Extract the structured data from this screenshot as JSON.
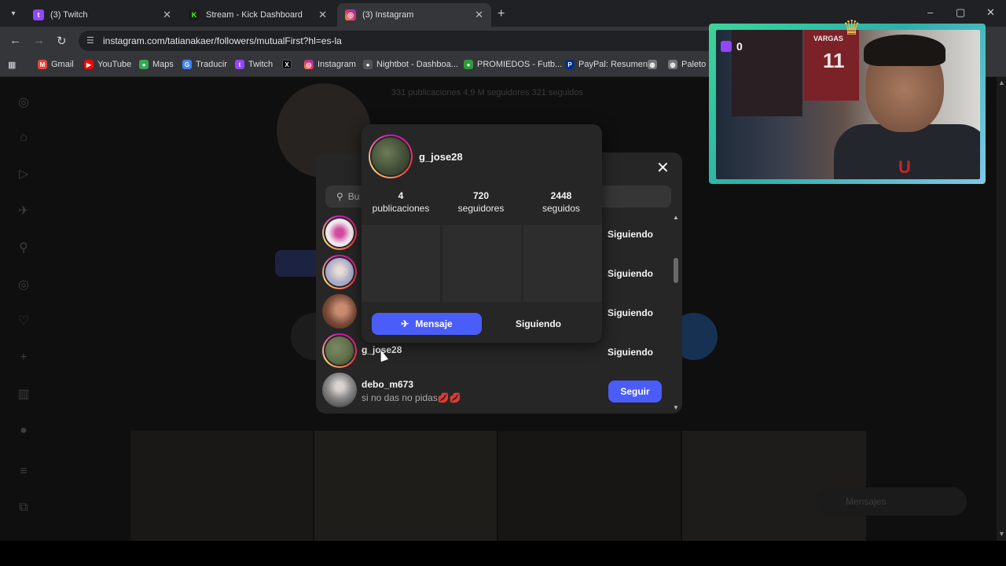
{
  "browser": {
    "tabs": [
      {
        "title": "(3) Twitch",
        "icon": "twitch-icon",
        "color": "#9146ff",
        "active": false
      },
      {
        "title": "Stream - Kick Dashboard",
        "icon": "kick-icon",
        "color": "#53fc18",
        "active": false
      },
      {
        "title": "(3) Instagram",
        "icon": "instagram-icon",
        "color": "#e1306c",
        "active": true
      }
    ],
    "url": "instagram.com/tatianakaer/followers/mutualFirst?hl=es-la",
    "bookmarks": [
      {
        "label": "Gmail",
        "icon": "gmail-icon",
        "color": "#ea4335"
      },
      {
        "label": "YouTube",
        "icon": "youtube-icon",
        "color": "#ff0000"
      },
      {
        "label": "Maps",
        "icon": "maps-icon",
        "color": "#34a853"
      },
      {
        "label": "Traducir",
        "icon": "translate-icon",
        "color": "#4285f4"
      },
      {
        "label": "Twitch",
        "icon": "twitch-icon",
        "color": "#9146ff"
      },
      {
        "label": "",
        "icon": "x-icon",
        "color": "#000000"
      },
      {
        "label": "Instagram",
        "icon": "instagram-icon",
        "color": "#e1306c"
      },
      {
        "label": "Nightbot - Dashboa...",
        "icon": "nightbot-icon",
        "color": "#666666"
      },
      {
        "label": "PROMIEDOS - Futb...",
        "icon": "promiedos-icon",
        "color": "#2e9a3a"
      },
      {
        "label": "PayPal: Resumen",
        "icon": "paypal-icon",
        "color": "#003087"
      },
      {
        "label": "",
        "icon": "globe-icon",
        "color": "#777777"
      },
      {
        "label": "Paleto",
        "icon": "globe-icon",
        "color": "#777777"
      }
    ]
  },
  "background_profile": {
    "stats": "331 publicaciones   4,9 M seguidores   321 seguidos",
    "messages_label": "Mensajes"
  },
  "followers_modal": {
    "search_placeholder": "Bu",
    "rows": [
      {
        "username": "",
        "bio": "",
        "button": "Siguiendo",
        "avatar_color": "#efe6ee",
        "ring": true
      },
      {
        "username": "",
        "bio": "",
        "button": "Siguiendo",
        "avatar_color": "#a7a9c8",
        "ring": true
      },
      {
        "username": "",
        "bio": "",
        "button": "Siguiendo",
        "avatar_color": "#7a4a38",
        "ring": false
      },
      {
        "username": "g_jose28",
        "bio": "",
        "button": "Siguiendo",
        "avatar_color": "#5f6f4a",
        "ring": true
      },
      {
        "username": "debo_m673",
        "bio": "si no das no pidas💋💋",
        "button": "Seguir",
        "avatar_color": "#8a8a8a",
        "ring": false
      }
    ]
  },
  "hover_card": {
    "username": "g_jose28",
    "stats": [
      {
        "value": "4",
        "label": "publicaciones"
      },
      {
        "value": "720",
        "label": "seguidores"
      },
      {
        "value": "2448",
        "label": "seguidos"
      }
    ],
    "message_label": "Mensaje",
    "following_label": "Siguiendo"
  },
  "webcam": {
    "viewer_count": "0",
    "jersey_text": "VARGAS",
    "jersey_number": "11"
  }
}
